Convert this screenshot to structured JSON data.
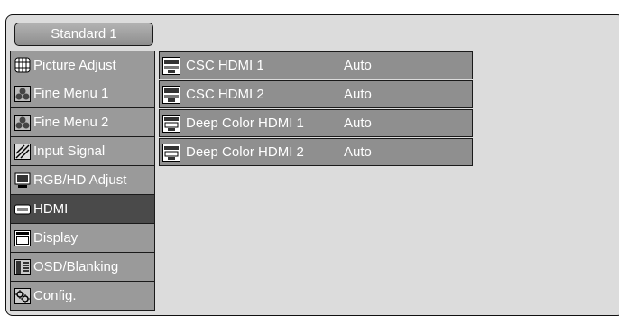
{
  "tab": {
    "label": "Standard 1"
  },
  "sidebar": {
    "items": [
      {
        "label": "Picture Adjust",
        "icon": "picture-adjust-icon",
        "active": false
      },
      {
        "label": "Fine Menu 1",
        "icon": "fine-menu-icon",
        "active": false
      },
      {
        "label": "Fine Menu 2",
        "icon": "fine-menu-icon",
        "active": false
      },
      {
        "label": "Input Signal",
        "icon": "input-signal-icon",
        "active": false
      },
      {
        "label": "RGB/HD Adjust",
        "icon": "monitor-icon",
        "active": false
      },
      {
        "label": "HDMI",
        "icon": "hdmi-icon",
        "active": true
      },
      {
        "label": "Display",
        "icon": "display-icon",
        "active": false
      },
      {
        "label": "OSD/Blanking",
        "icon": "osd-icon",
        "active": false
      },
      {
        "label": "Config.",
        "icon": "config-icon",
        "active": false
      }
    ]
  },
  "submenu": {
    "rows": [
      {
        "label": "CSC HDMI 1",
        "value": "Auto",
        "icon": "csc-icon"
      },
      {
        "label": "CSC HDMI 2",
        "value": "Auto",
        "icon": "csc-icon"
      },
      {
        "label": "Deep Color HDMI 1",
        "value": "Auto",
        "icon": "deep-color-icon"
      },
      {
        "label": "Deep Color HDMI 2",
        "value": "Auto",
        "icon": "deep-color-icon"
      }
    ]
  },
  "colors": {
    "background": "#dcdcdc",
    "item": "#9a9a9a",
    "active_item": "#4a4a4a",
    "submenu_row": "#8f8f8f"
  }
}
